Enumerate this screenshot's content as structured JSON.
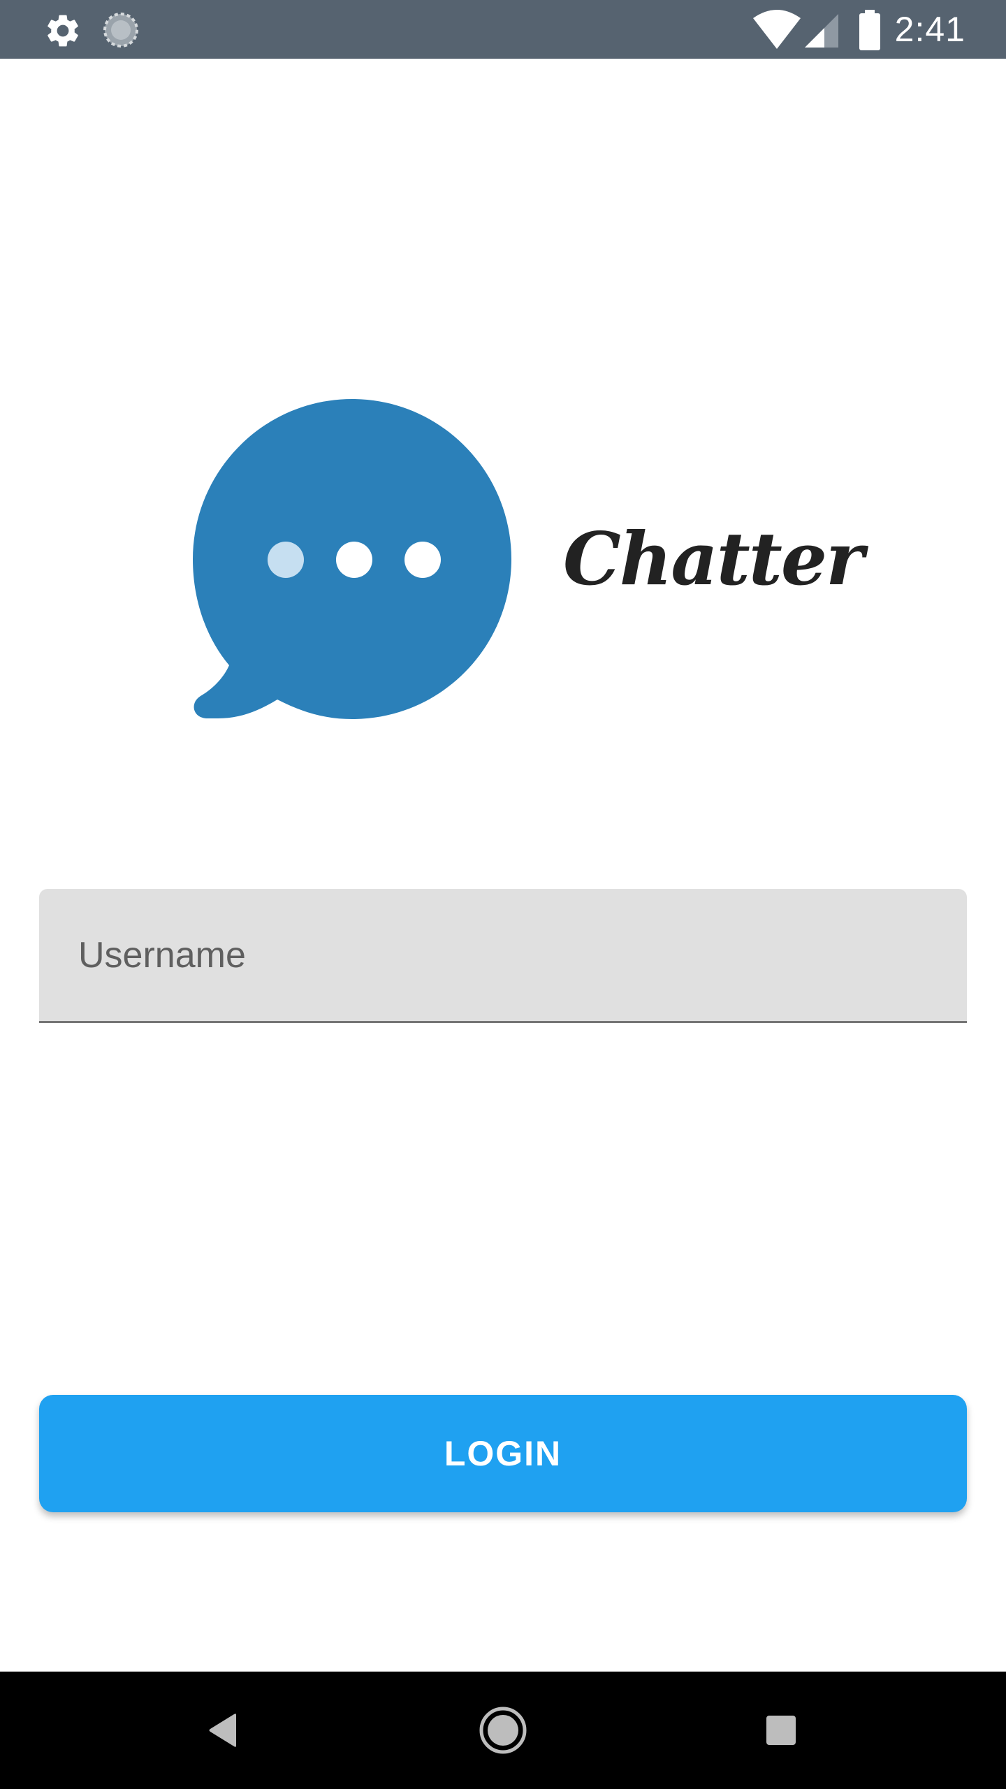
{
  "status_bar": {
    "time": "2:41",
    "icons": {
      "left": [
        "settings-gear-icon",
        "loading-spinner-icon"
      ],
      "right": [
        "wifi-icon",
        "cellular-signal-icon",
        "battery-icon"
      ]
    },
    "background_color": "#566370"
  },
  "app": {
    "name": "Chatter",
    "logo_icon": "chat-bubble-icon",
    "brand_color": "#2b80b9"
  },
  "login_form": {
    "username_placeholder": "Username",
    "username_value": "",
    "login_label": "LOGIN",
    "button_color": "#1fa1f1"
  },
  "nav_bar": {
    "buttons": [
      "back-icon",
      "home-icon",
      "recents-icon"
    ]
  }
}
